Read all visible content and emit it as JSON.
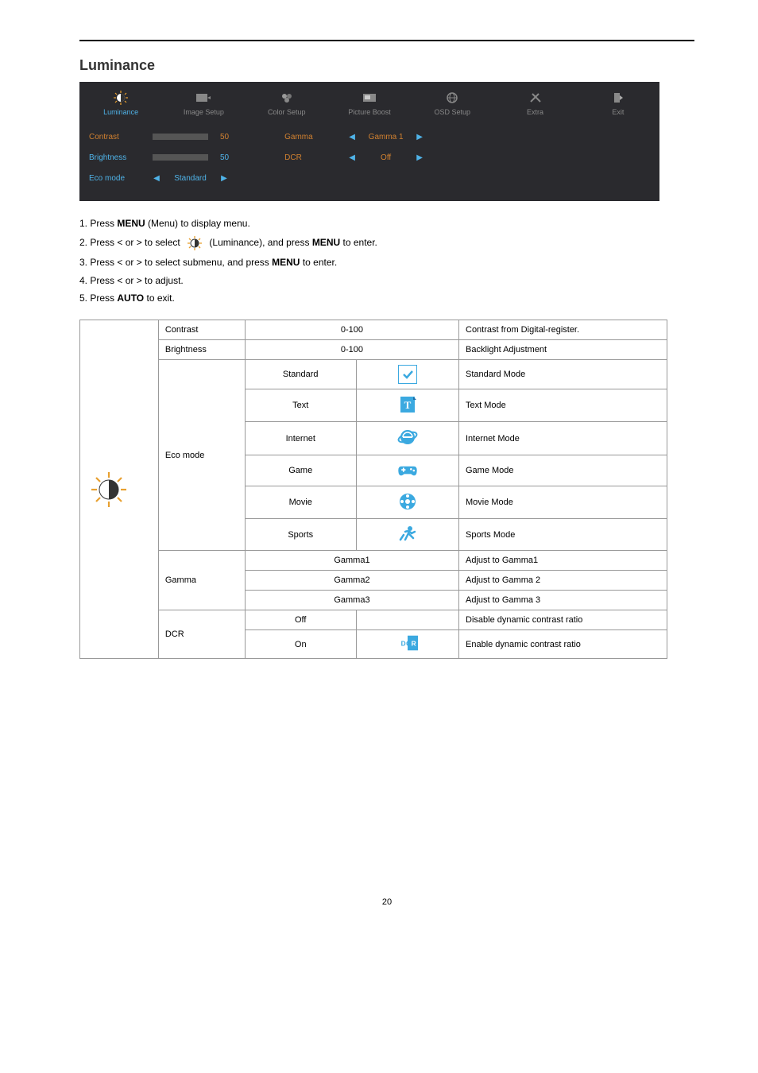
{
  "page": {
    "section_title": "Luminance",
    "page_number": "20"
  },
  "osd": {
    "tabs": [
      {
        "label": "Luminance",
        "icon": "sun-contrast-icon",
        "active": true
      },
      {
        "label": "Image Setup",
        "icon": "image-setup-icon",
        "active": false
      },
      {
        "label": "Color Setup",
        "icon": "color-dots-icon",
        "active": false
      },
      {
        "label": "Picture Boost",
        "icon": "picture-boost-icon",
        "active": false
      },
      {
        "label": "OSD Setup",
        "icon": "globe-icon",
        "active": false
      },
      {
        "label": "Extra",
        "icon": "tools-icon",
        "active": false
      },
      {
        "label": "Exit",
        "icon": "exit-icon",
        "active": false
      }
    ],
    "left_rows": [
      {
        "label": "Contrast",
        "value": "50",
        "selected": true
      },
      {
        "label": "Brightness",
        "value": "50",
        "selected": false
      },
      {
        "label": "Eco mode",
        "value": "Standard",
        "selected": false,
        "arrows": true
      }
    ],
    "right_rows": [
      {
        "label": "Gamma",
        "value": "Gamma 1"
      },
      {
        "label": "DCR",
        "value": "Off"
      }
    ]
  },
  "instructions": {
    "step1_pre": "1. Press ",
    "step1_mid": " (Menu) to display menu.",
    "step2_pre": "2. Press < or > to select ",
    "step2_mid": " (Luminance), and press ",
    "step2_end": " to enter.",
    "step3_pre": "3. Press < or > to select submenu, and press ",
    "step3_end": " to enter.",
    "step4": "4. Press < or > to adjust.",
    "step5_pre": "5. Press ",
    "step5_end": " to exit."
  },
  "menu_word": "MENU",
  "auto_word": "AUTO",
  "table": {
    "rows": [
      {
        "label": "Contrast",
        "option": "0-100",
        "option_colspan": 2,
        "desc": "Contrast from Digital-register."
      },
      {
        "label": "Brightness",
        "option": "0-100",
        "option_colspan": 2,
        "desc": "Backlight Adjustment"
      }
    ],
    "eco_label": "Eco mode",
    "eco_options": [
      {
        "name": "Standard",
        "icon": "check-icon",
        "desc": "Standard Mode"
      },
      {
        "name": "Text",
        "icon": "text-icon",
        "desc": "Text Mode"
      },
      {
        "name": "Internet",
        "icon": "ie-icon",
        "desc": "Internet Mode"
      },
      {
        "name": "Game",
        "icon": "gamepad-icon",
        "desc": "Game Mode"
      },
      {
        "name": "Movie",
        "icon": "movie-icon",
        "desc": "Movie Mode"
      },
      {
        "name": "Sports",
        "icon": "sports-icon",
        "desc": "Sports Mode"
      }
    ],
    "gamma_label": "Gamma",
    "gamma_options": [
      {
        "name": "Gamma1",
        "desc": "Adjust to Gamma1"
      },
      {
        "name": "Gamma2",
        "desc": "Adjust to Gamma 2"
      },
      {
        "name": "Gamma3",
        "desc": "Adjust to Gamma 3"
      }
    ],
    "dcr_label": "DCR",
    "dcr_options": [
      {
        "name": "Off",
        "icon": null,
        "desc": "Disable dynamic contrast ratio"
      },
      {
        "name": "On",
        "icon": "dcr-icon",
        "desc": "Enable dynamic contrast ratio"
      }
    ]
  }
}
